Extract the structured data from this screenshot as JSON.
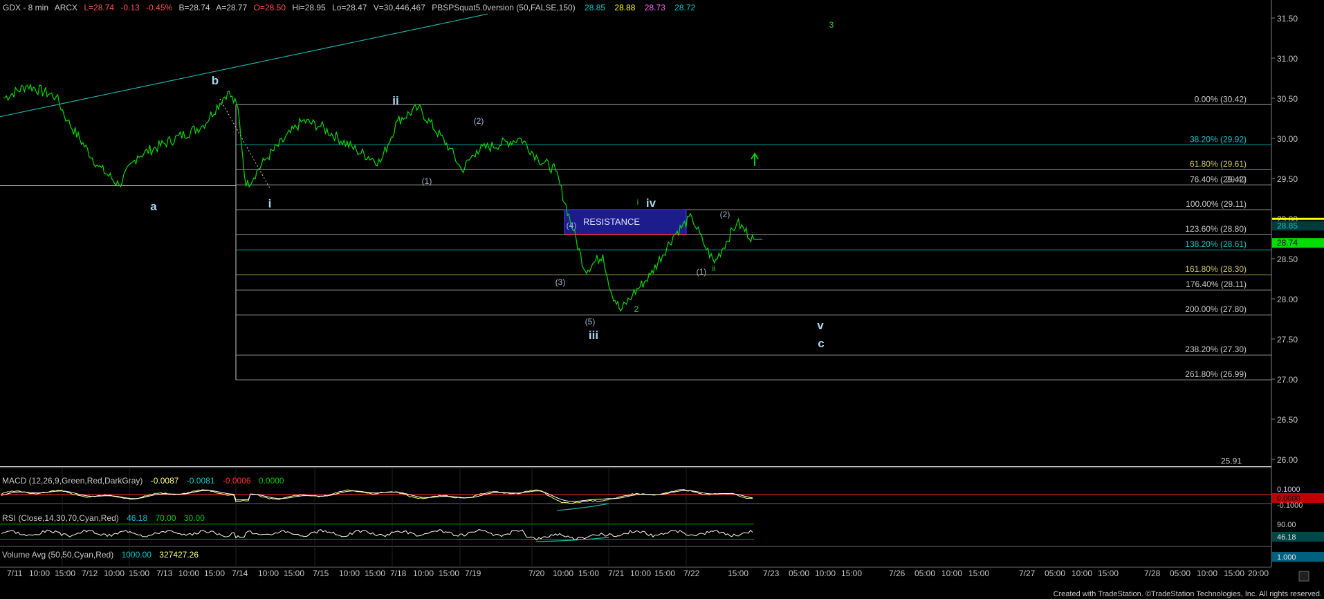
{
  "header": {
    "symbol": "GDX - 8 min",
    "exchange": "ARCX",
    "last": "L=28.74",
    "change": "-0.13",
    "pct": "-0.45%",
    "bid": "B=28.74",
    "ask": "A=28.77",
    "open": "O=28.50",
    "high": "Hi=28.95",
    "low": "Lo=28.47",
    "volume": "V=30,446,467",
    "study": "PBSPSquat5.0version (50,FALSE,150)",
    "study_values": [
      {
        "text": "28.85",
        "color": "#00c8c8"
      },
      {
        "text": "28.88",
        "color": "#ffff00"
      },
      {
        "text": "28.73",
        "color": "#ff66ff"
      },
      {
        "text": "28.72",
        "color": "#00c8c8"
      }
    ]
  },
  "macd_header": {
    "label": "MACD (12,26,9,Green,Red,DarkGray)",
    "values": [
      {
        "text": "-0.0087",
        "color": "#ffff80"
      },
      {
        "text": "-0.0081",
        "color": "#00c8c8"
      },
      {
        "text": "-0.0006",
        "color": "#ff3030"
      },
      {
        "text": "0.0000",
        "color": "#00cc00"
      }
    ]
  },
  "rsi_header": {
    "label": "RSI (Close,14,30,70,Cyan,Red)",
    "values": [
      {
        "text": "46.18",
        "color": "#00c8c8"
      },
      {
        "text": "70.00",
        "color": "#00cc00"
      },
      {
        "text": "30.00",
        "color": "#00cc00"
      }
    ]
  },
  "vol_header": {
    "label": "Volume Avg (50,50,Cyan,Red)",
    "values": [
      {
        "text": "1000.00",
        "color": "#00c8c8"
      },
      {
        "text": "327427.26",
        "color": "#ffff80"
      }
    ]
  },
  "price_axis": {
    "ticks": [
      "31.50",
      "31.00",
      "30.50",
      "30.00",
      "29.50",
      "29.00",
      "28.50",
      "28.00",
      "27.50",
      "27.00",
      "26.50",
      "26.00"
    ],
    "last_labels": [
      {
        "text": "28.85",
        "color": "#00c8c8",
        "bg": "#003a3a"
      },
      {
        "text": "28.74",
        "color": "#000000",
        "bg": "#00dd00"
      }
    ]
  },
  "macd_axis": {
    "ticks": [
      "0.1000",
      "-0.1000"
    ],
    "current": "0.0000"
  },
  "rsi_axis": {
    "ticks": [
      "90.00"
    ],
    "current": "46.18"
  },
  "vol_axis": {
    "current": "1.000"
  },
  "time_axis": [
    "7/11",
    "10:00",
    "15:00",
    "7/12",
    "10:00",
    "15:00",
    "7/13",
    "10:00",
    "15:00",
    "7/14",
    "10:00",
    "15:00",
    "7/15",
    "10:00",
    "15:00",
    "7/18",
    "10:00",
    "15:00",
    "7/19",
    "7/20",
    "10:00",
    "15:00",
    "7/21",
    "10:00",
    "15:00",
    "7/22",
    "15:00",
    "7/23",
    "05:00",
    "10:00",
    "15:00",
    "7/26",
    "05:00",
    "10:00",
    "15:00",
    "7/27",
    "05:00",
    "10:00",
    "15:00",
    "7/28",
    "05:00",
    "10:00",
    "15:00",
    "20:00"
  ],
  "fib_levels": [
    {
      "label": "0.00% (30.42)",
      "price": 30.42,
      "color": "#c8c8c8"
    },
    {
      "label": "38.20% (29.92)",
      "price": 29.92,
      "color": "#00c8c8"
    },
    {
      "label": "61.80% (29.61)",
      "price": 29.61,
      "color": "#c8c864"
    },
    {
      "label": "76.40% (29.42)",
      "price": 29.42,
      "color": "#c8c8c8"
    },
    {
      "label": "100.00% (29.11)",
      "price": 29.11,
      "color": "#c8c8c8"
    },
    {
      "label": "123.60% (28.80)",
      "price": 28.8,
      "color": "#c8c8c8"
    },
    {
      "label": "138.20% (28.61)",
      "price": 28.61,
      "color": "#00c8c8"
    },
    {
      "label": "161.80% (28.30)",
      "price": 28.3,
      "color": "#c8c864"
    },
    {
      "label": "176.40% (28.11)",
      "price": 28.11,
      "color": "#c8c8c8"
    },
    {
      "label": "200.00% (27.80)",
      "price": 27.8,
      "color": "#c8c8c8"
    },
    {
      "label": "238.20% (27.30)",
      "price": 27.3,
      "color": "#c8c8c8"
    },
    {
      "label": "261.80% (26.99)",
      "price": 26.99,
      "color": "#c8c8c8"
    }
  ],
  "overlap_label": "29.42",
  "level_2591": "25.91",
  "resistance": {
    "label": "RESISTANCE",
    "top": 29.11,
    "bottom": 28.8
  },
  "wave_labels": [
    {
      "text": "a",
      "color": "#a8d8f0",
      "bold": true
    },
    {
      "text": "b",
      "color": "#a8d8f0",
      "bold": true
    },
    {
      "text": "i",
      "color": "#a8d8f0",
      "bold": true
    },
    {
      "text": "ii",
      "color": "#a8d8f0",
      "bold": true
    },
    {
      "text": "(1)",
      "color": "#a0b4d0",
      "bold": false
    },
    {
      "text": "(2)",
      "color": "#a0b4d0",
      "bold": false
    },
    {
      "text": "(3)",
      "color": "#a0b4d0",
      "bold": false
    },
    {
      "text": "(4)",
      "color": "#a0b4d0",
      "bold": false
    },
    {
      "text": "(5)",
      "color": "#a0b4d0",
      "bold": false
    },
    {
      "text": "iii",
      "color": "#a8d8f0",
      "bold": true
    },
    {
      "text": "i",
      "color": "#33cc33",
      "bold": false
    },
    {
      "text": "2",
      "color": "#33cc33",
      "bold": false
    },
    {
      "text": "iv",
      "color": "#a8d8f0",
      "bold": true
    },
    {
      "text": "(1)",
      "color": "#a0b4d0",
      "bold": false
    },
    {
      "text": "ii",
      "color": "#33cc33",
      "bold": false
    },
    {
      "text": "(2)",
      "color": "#a0b4d0",
      "bold": false
    },
    {
      "text": "3",
      "color": "#33cc33",
      "bold": false
    },
    {
      "text": "v",
      "color": "#a8d8f0",
      "bold": true
    },
    {
      "text": "c",
      "color": "#a8d8f0",
      "bold": true
    }
  ],
  "footer": "Created with TradeStation. ©TradeStation Technologies, Inc. All rights reserved.",
  "colors": {
    "price": "#00dd00",
    "trendline": "#20b2aa",
    "resistance_fill": "#1c1c8c",
    "macd": "#ffff80",
    "signal": "#ffffff",
    "rsi": "#ffffff"
  },
  "chart_data": {
    "type": "line",
    "title": "GDX - 8 min",
    "x": [
      "7/11 09:30",
      "7/11 12:00",
      "7/11 15:00",
      "7/12 10:00",
      "7/12 13:00",
      "7/12 15:00",
      "7/13 10:00",
      "7/13 14:00",
      "7/13 15:30",
      "7/14 09:40",
      "7/14 10:20",
      "7/14 12:00",
      "7/14 15:00",
      "7/15 10:00",
      "7/15 13:00",
      "7/15 15:00",
      "7/18 10:00",
      "7/18 12:00",
      "7/18 15:00",
      "7/19 09:40",
      "7/19 11:00",
      "7/19 15:00",
      "7/20 10:00",
      "7/20 11:30",
      "7/20 13:00",
      "7/20 14:00",
      "7/20 15:30",
      "7/21 09:40",
      "7/21 10:30",
      "7/21 11:30",
      "7/21 13:00",
      "7/21 15:00",
      "7/22 10:00",
      "7/22 11:00",
      "7/22 12:00",
      "7/22 14:00",
      "7/22 15:30"
    ],
    "values": [
      30.5,
      30.66,
      30.52,
      30.22,
      29.65,
      29.42,
      29.78,
      30.16,
      30.58,
      30.38,
      29.4,
      29.75,
      30.22,
      30.15,
      29.85,
      29.7,
      30.22,
      30.38,
      29.88,
      29.6,
      29.85,
      30.0,
      29.75,
      29.6,
      28.85,
      28.35,
      28.55,
      28.1,
      27.85,
      28.05,
      28.3,
      28.8,
      29.02,
      28.7,
      28.45,
      28.95,
      28.74
    ],
    "series": [
      {
        "name": "GDX",
        "values": [
          30.5,
          30.66,
          30.52,
          30.22,
          29.65,
          29.42,
          29.78,
          30.16,
          30.58,
          30.38,
          29.4,
          29.75,
          30.22,
          30.15,
          29.85,
          29.7,
          30.22,
          30.38,
          29.88,
          29.6,
          29.85,
          30.0,
          29.75,
          29.6,
          28.85,
          28.35,
          28.55,
          28.1,
          27.85,
          28.05,
          28.3,
          28.8,
          29.02,
          28.7,
          28.45,
          28.95,
          28.74
        ]
      }
    ],
    "ylim": [
      25.75,
      31.75
    ],
    "grid": false,
    "indicators": {
      "macd": -0.0087,
      "macd_avg": -0.0081,
      "macd_diff": -0.0006,
      "rsi": 46.18,
      "volume_avg": 327427.26
    }
  }
}
